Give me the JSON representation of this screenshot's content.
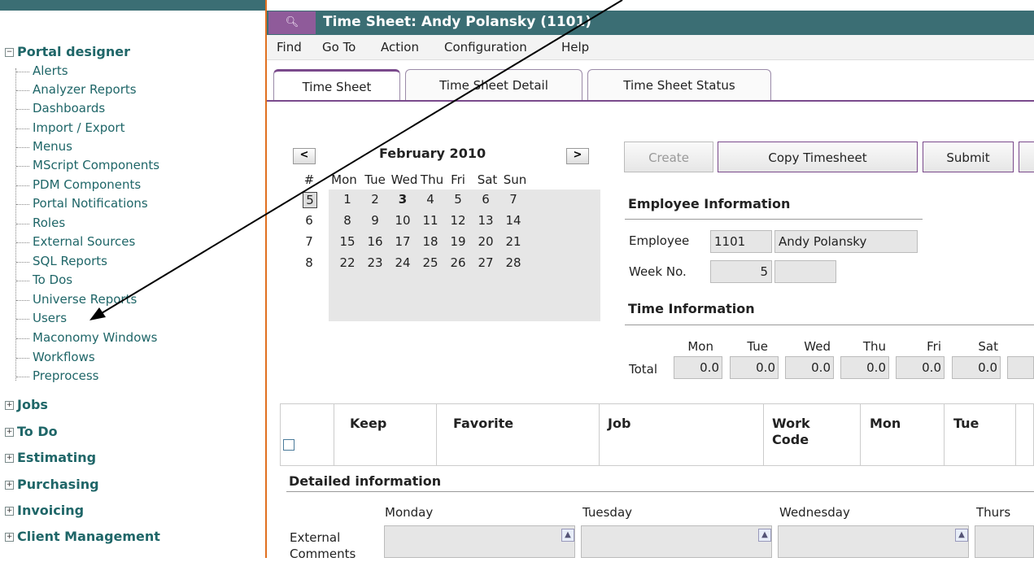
{
  "window": {
    "title": "Time Sheet: Andy Polansky (1101)"
  },
  "sidebar": {
    "root": {
      "label": "Portal designer",
      "expanded": true
    },
    "items": [
      "Alerts",
      "Analyzer Reports",
      "Dashboards",
      "Import / Export",
      "Menus",
      "MScript Components",
      "PDM Components",
      "Portal Notifications",
      "Roles",
      "External Sources",
      "SQL Reports",
      "To Dos",
      "Universe Reports",
      "Users",
      "Maconomy Windows",
      "Workflows",
      "Preprocess"
    ],
    "groups": [
      "Jobs",
      "To Do",
      "Estimating",
      "Purchasing",
      "Invoicing",
      "Client Management"
    ]
  },
  "menu": [
    "Find",
    "Go To",
    "Action",
    "Configuration",
    "Help"
  ],
  "tabs": [
    "Time Sheet",
    "Time Sheet Detail",
    "Time Sheet Status"
  ],
  "calendar": {
    "month": "February 2010",
    "prev": "<",
    "next": ">",
    "week_header": "#",
    "days": [
      "Mon",
      "Tue",
      "Wed",
      "Thu",
      "Fri",
      "Sat",
      "Sun"
    ],
    "weeks": [
      {
        "wk": "5",
        "days": [
          "1",
          "2",
          "3",
          "4",
          "5",
          "6",
          "7"
        ]
      },
      {
        "wk": "6",
        "days": [
          "8",
          "9",
          "10",
          "11",
          "12",
          "13",
          "14"
        ]
      },
      {
        "wk": "7",
        "days": [
          "15",
          "16",
          "17",
          "18",
          "19",
          "20",
          "21"
        ]
      },
      {
        "wk": "8",
        "days": [
          "22",
          "23",
          "24",
          "25",
          "26",
          "27",
          "28"
        ]
      }
    ]
  },
  "buttons": {
    "create": "Create",
    "copy": "Copy Timesheet",
    "submit": "Submit"
  },
  "employee": {
    "section": "Employee Information",
    "employee_label": "Employee",
    "employee_no": "1101",
    "employee_name": "Andy Polansky",
    "week_label": "Week No.",
    "week_no": "5"
  },
  "time_info": {
    "section": "Time Information",
    "days": [
      "Mon",
      "Tue",
      "Wed",
      "Thu",
      "Fri",
      "Sat"
    ],
    "total_label": "Total",
    "totals": [
      "0.0",
      "0.0",
      "0.0",
      "0.0",
      "0.0",
      "0.0"
    ]
  },
  "grid": {
    "columns": [
      "Keep",
      "Favorite",
      "Job",
      "Work Code",
      "Mon",
      "Tue"
    ]
  },
  "detail": {
    "section": "Detailed information",
    "days": [
      "Monday",
      "Tuesday",
      "Wednesday",
      "Thurs"
    ],
    "row_label": "External Comments"
  }
}
